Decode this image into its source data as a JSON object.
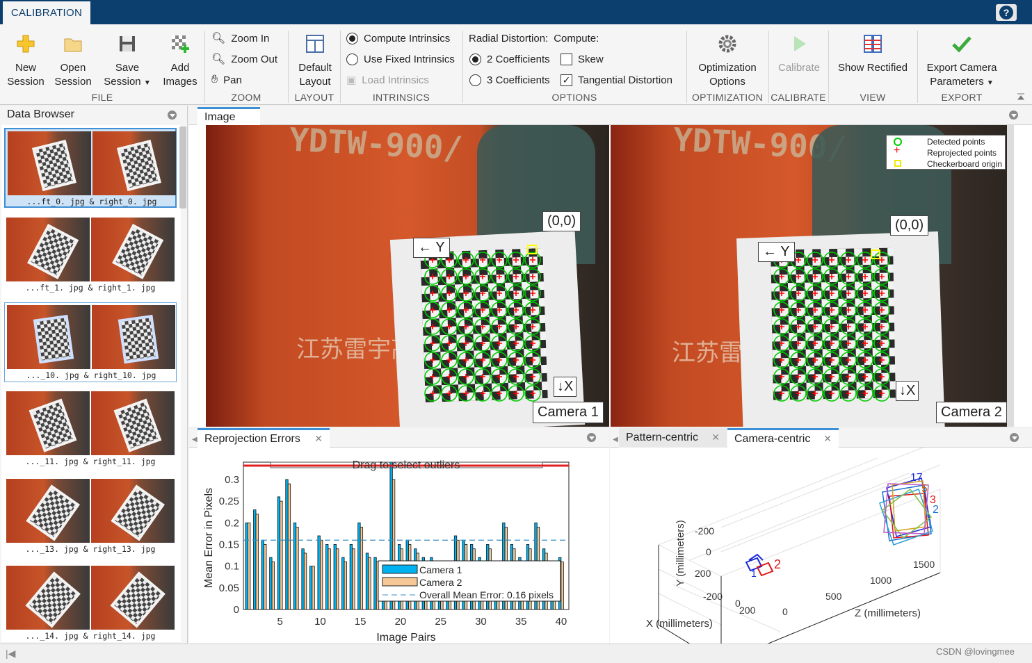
{
  "app": {
    "tab": "CALIBRATION",
    "help": "?"
  },
  "ribbon": {
    "file": {
      "group": "FILE",
      "new": [
        "New",
        "Session"
      ],
      "open": [
        "Open",
        "Session"
      ],
      "save": [
        "Save",
        "Session"
      ],
      "add": [
        "Add",
        "Images"
      ]
    },
    "zoom": {
      "group": "ZOOM",
      "zoom_in": "Zoom In",
      "zoom_out": "Zoom Out",
      "pan": "Pan"
    },
    "layout": {
      "group": "LAYOUT",
      "default": [
        "Default",
        "Layout"
      ]
    },
    "intrinsics": {
      "group": "INTRINSICS",
      "compute": "Compute Intrinsics",
      "fixed": "Use Fixed Intrinsics",
      "load": "Load Intrinsics",
      "selected": "compute"
    },
    "options": {
      "group": "OPTIONS",
      "radial_label": "Radial Distortion:",
      "compute_label": "Compute:",
      "two": "2 Coefficients",
      "three": "3 Coefficients",
      "skew": "Skew",
      "tangential": "Tangential Distortion",
      "radial_selected": "2",
      "skew_checked": false,
      "tangential_checked": true
    },
    "optimization": {
      "group": "OPTIMIZATION",
      "button": [
        "Optimization",
        "Options"
      ]
    },
    "calibrate": {
      "group": "CALIBRATE",
      "button": "Calibrate"
    },
    "view": {
      "group": "VIEW",
      "button": "Show Rectified"
    },
    "export": {
      "group": "EXPORT",
      "button": [
        "Export Camera",
        "Parameters"
      ]
    }
  },
  "data_browser": {
    "title": "Data Browser",
    "items": [
      {
        "label": "...ft_0. jpg & right_0. jpg",
        "selected": true
      },
      {
        "label": "...ft_1. jpg & right_1. jpg",
        "selected": false
      },
      {
        "label": "..._10. jpg & right_10. jpg",
        "selected": false
      },
      {
        "label": "..._11. jpg & right_11. jpg",
        "selected": false
      },
      {
        "label": "..._13. jpg & right_13. jpg",
        "selected": false
      },
      {
        "label": "..._14. jpg & right_14. jpg",
        "selected": false
      }
    ]
  },
  "image_panel": {
    "tab": "Image",
    "cam1": {
      "label": "Camera 1",
      "origin": "(0,0)",
      "y": "← Y",
      "x": "↓X",
      "banner": "YDTW-900/",
      "chinese": "江苏雷宇高电"
    },
    "cam2": {
      "label": "Camera 2",
      "origin": "(0,0)",
      "y": "← Y",
      "x": "↓X",
      "banner": "YDTW-900/",
      "chinese": "江苏雷宇"
    },
    "legend": [
      "Detected points",
      "Reprojected points",
      "Checkerboard origin"
    ],
    "colors": {
      "detected": "#00cc00",
      "reprojected": "#ff0000",
      "origin": "#ffff00"
    }
  },
  "reprojection": {
    "tab": "Reprojection Errors",
    "drag_text": "Drag to select outliers",
    "chart_data": {
      "type": "bar",
      "xlabel": "Image Pairs",
      "ylabel": "Mean Error in Pixels",
      "ylim": [
        0,
        0.34
      ],
      "x_ticks": [
        5,
        10,
        15,
        20,
        25,
        30,
        35,
        40
      ],
      "y_ticks": [
        "0",
        "0.05",
        "0.1",
        "0.15",
        "0.2",
        "0.25",
        "0.3"
      ],
      "overall_mean": 0.16,
      "legend": [
        "Camera 1",
        "Camera 2",
        "Overall Mean Error: 0.16 pixels"
      ],
      "colors": {
        "cam1": "#00b3f0",
        "cam2": "#f5c896",
        "mean": "#3a8fc4"
      },
      "series": [
        {
          "name": "Camera 1",
          "values": [
            0.2,
            0.23,
            0.16,
            0.12,
            0.26,
            0.3,
            0.2,
            0.14,
            0.1,
            0.17,
            0.15,
            0.15,
            0.12,
            0.15,
            0.2,
            0.13,
            0.12,
            0.1,
            0.34,
            0.15,
            0.16,
            0.14,
            0.12,
            0.12,
            0.1,
            0.1,
            0.17,
            0.16,
            0.15,
            0.12,
            0.15,
            0.1,
            0.2,
            0.15,
            0.12,
            0.15,
            0.2,
            0.14,
            0.1,
            0.12
          ]
        },
        {
          "name": "Camera 2",
          "values": [
            0.2,
            0.22,
            0.15,
            0.11,
            0.25,
            0.29,
            0.19,
            0.13,
            0.1,
            0.16,
            0.14,
            0.14,
            0.11,
            0.14,
            0.19,
            0.12,
            0.11,
            0.1,
            0.3,
            0.14,
            0.15,
            0.13,
            0.11,
            0.11,
            0.09,
            0.1,
            0.16,
            0.15,
            0.14,
            0.11,
            0.14,
            0.09,
            0.19,
            0.14,
            0.11,
            0.14,
            0.19,
            0.13,
            0.09,
            0.11
          ]
        }
      ]
    }
  },
  "extrinsics": {
    "tab_pattern": "Pattern-centric",
    "tab_camera": "Camera-centric",
    "ylabel": "Y (millimeters)",
    "xlabel": "X (millimeters)",
    "zlabel": "Z (millimeters)",
    "y_ticks": [
      "-200",
      "0",
      "200"
    ],
    "x_ticks": [
      "-200",
      "0",
      "200"
    ],
    "z_ticks": [
      "0",
      "500",
      "1000",
      "1500"
    ],
    "cam_labels": [
      "1",
      "2"
    ],
    "pattern_labels": [
      "17",
      "5",
      "3",
      "2"
    ],
    "cam_colors": {
      "cam1": "#1a28d8",
      "cam2": "#e01818"
    }
  },
  "watermark": "CSDN @lovingmee"
}
